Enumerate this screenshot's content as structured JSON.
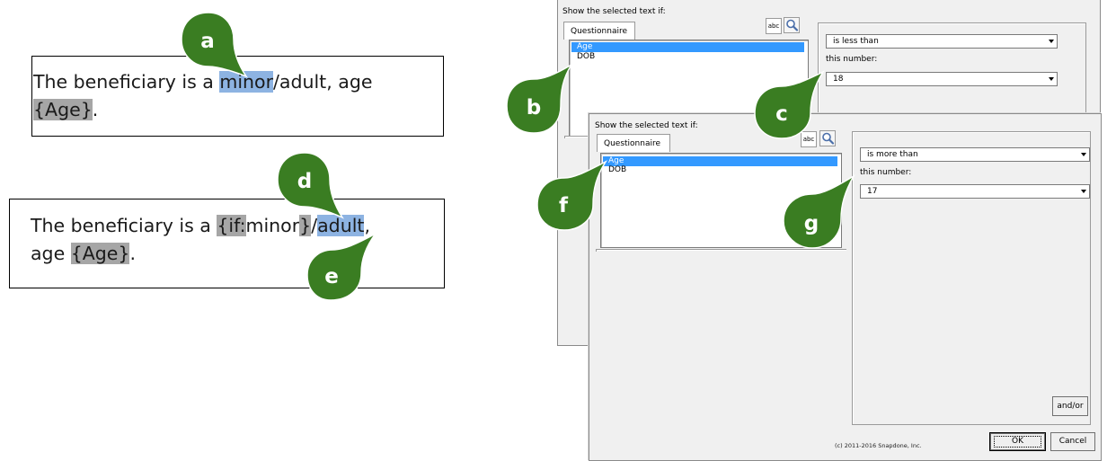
{
  "example_before": {
    "line1_prefix": "The beneficiary is a ",
    "highlight_minor": "minor",
    "line1_suffix": "/adult, age",
    "field_age": "{Age}",
    "period": "."
  },
  "example_after": {
    "prefix": "The beneficiary is a ",
    "field_if_open": "{if:",
    "minor": "minor",
    "field_if_close": "}",
    "slash": "/",
    "highlight_adult": "adult",
    "comma": ",",
    "line2_prefix": "age ",
    "field_age": "{Age}",
    "period": "."
  },
  "callouts": {
    "a": "a",
    "b": "b",
    "c": "c",
    "d": "d",
    "e": "e",
    "f": "f",
    "g": "g"
  },
  "dialog_back": {
    "heading": "Show the selected text if:",
    "tab_label": "Questionnaire",
    "abc_label": "abc",
    "list_items": [
      "Age",
      "DOB"
    ],
    "condition_value": "is less than",
    "number_label": "this number:",
    "number_value": "18"
  },
  "dialog_front": {
    "heading": "Show the selected text if:",
    "tab_label": "Questionnaire",
    "abc_label": "abc",
    "list_items": [
      "Age",
      "DOB"
    ],
    "condition_value": "is more than",
    "number_label": "this number:",
    "number_value": "17",
    "andor_label": "and/or",
    "copyright": "(c) 2011-2016 Snapdone, Inc.",
    "ok_label": "OK",
    "cancel_label": "Cancel"
  },
  "colors": {
    "callout_green": "#3a7d22",
    "highlight_blue": "#8db3e2",
    "highlight_gray": "#a6a6a6",
    "selection_blue": "#3399ff"
  },
  "icons": {
    "search": "magnifier-icon",
    "dropdown": "chevron-down-icon"
  }
}
